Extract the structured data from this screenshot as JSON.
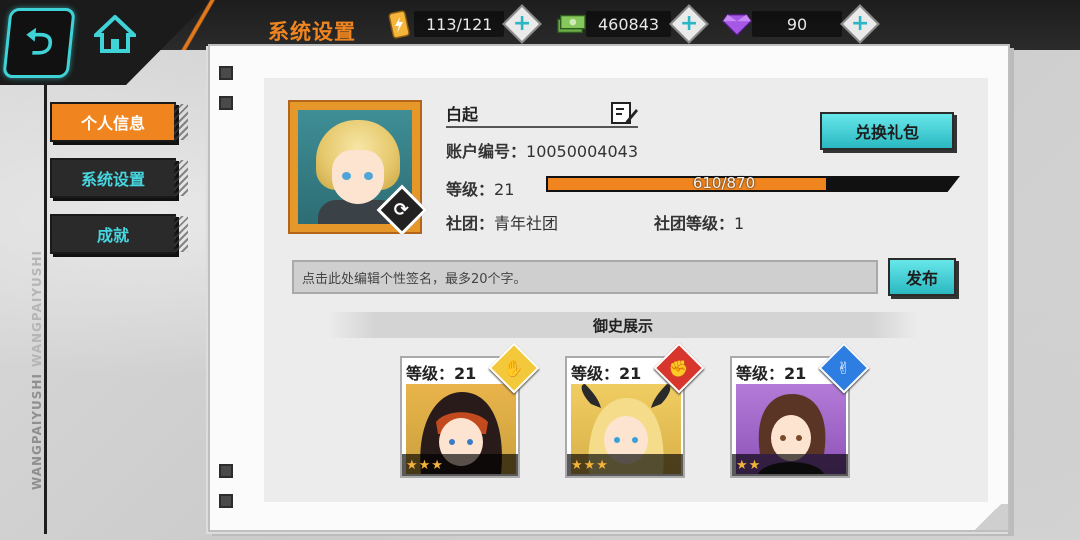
{
  "header": {
    "title": "系统设置",
    "resources": [
      {
        "icon": "energy-can-icon",
        "value": "113/121"
      },
      {
        "icon": "cash-icon",
        "value": "460843"
      },
      {
        "icon": "gem-icon",
        "value": "90"
      }
    ]
  },
  "side_text": [
    "WANGPAIYUSHI",
    "WANGPAIYUSHI"
  ],
  "menu": [
    {
      "label": "个人信息",
      "active": true
    },
    {
      "label": "系统设置",
      "active": false
    },
    {
      "label": "成就",
      "active": false
    }
  ],
  "profile": {
    "name": "白起",
    "account_label": "账户编号：",
    "account_id": "10050004043",
    "level_label": "等级：",
    "level": "21",
    "exp": "610/870",
    "exp_fraction": 0.701,
    "club_label": "社团：",
    "club": "青年社团",
    "club_level_label": "社团等级：",
    "club_level": "1",
    "redeem_button": "兑换礼包",
    "signature_placeholder": "点击此处编辑个性签名，最多20个字。",
    "publish_button": "发布"
  },
  "showcase": {
    "title": "御史展示",
    "cards": [
      {
        "level_label": "等级：",
        "level": "21",
        "stars": "★★★",
        "hand": "paper",
        "badge_color": "#f3c83a",
        "theme": "hood"
      },
      {
        "level_label": "等级：",
        "level": "21",
        "stars": "★★★",
        "hand": "rock",
        "badge_color": "#d8362d",
        "theme": "horns"
      },
      {
        "level_label": "等级：",
        "level": "21",
        "stars": "★★",
        "hand": "scissors",
        "badge_color": "#2e7de0",
        "theme": "brown"
      }
    ]
  }
}
